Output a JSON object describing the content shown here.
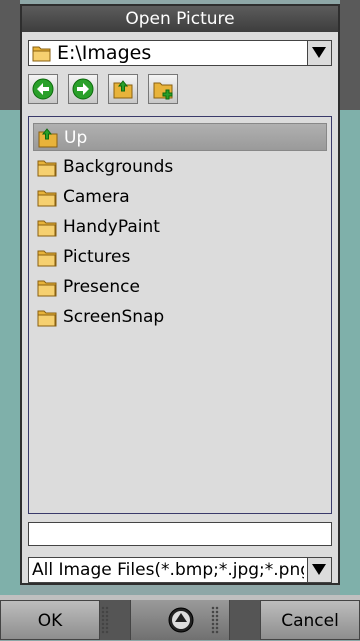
{
  "dialog": {
    "title": "Open Picture",
    "path": "E:\\Images",
    "toolbar": [
      {
        "name": "back-button",
        "icon": "green-left-arrow-icon"
      },
      {
        "name": "forward-button",
        "icon": "green-right-arrow-icon"
      },
      {
        "name": "up-folder-button",
        "icon": "folder-up-icon"
      },
      {
        "name": "new-folder-button",
        "icon": "folder-new-icon"
      }
    ],
    "items": [
      {
        "label": "Up",
        "icon": "folder-up-icon",
        "selected": true
      },
      {
        "label": "Backgrounds",
        "icon": "folder-icon"
      },
      {
        "label": "Camera",
        "icon": "folder-icon"
      },
      {
        "label": "HandyPaint",
        "icon": "folder-icon"
      },
      {
        "label": "Pictures",
        "icon": "folder-icon"
      },
      {
        "label": "Presence",
        "icon": "folder-icon"
      },
      {
        "label": "ScreenSnap",
        "icon": "folder-icon"
      }
    ],
    "filename_value": "",
    "filter_value": "All Image Files(*.bmp;*.jpg;*.png;*.gif)",
    "colors": {
      "title_bg": "#444444",
      "selection": "#a8a8a8",
      "folder": "#e8b33a"
    }
  },
  "softkeys": {
    "left": "OK",
    "right": "Cancel",
    "center_icon": "menu-up-arrow-icon"
  }
}
